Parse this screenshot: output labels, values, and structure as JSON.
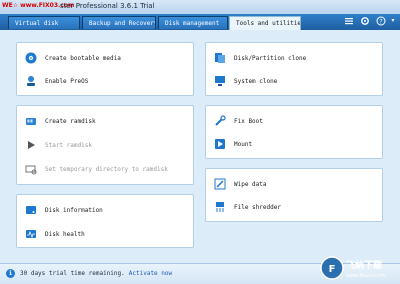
{
  "window": {
    "watermark": "WE☆ www.FIX03.com",
    "title": "ster Professional 3.6.1 Trial",
    "menu_icon": "menu-icon",
    "settings_icon": "gear-icon",
    "help_icon": "help-icon"
  },
  "tabs": [
    {
      "label": "Virtual disk",
      "active": false
    },
    {
      "label": "Backup and Recovery",
      "active": false
    },
    {
      "label": "Disk management",
      "active": false
    },
    {
      "label": "Tools and utilities",
      "active": true
    }
  ],
  "panels": {
    "boot": {
      "items": [
        {
          "label": "Create bootable media",
          "icon": "disc-icon",
          "enabled": true
        },
        {
          "label": "Enable PreOS",
          "icon": "preos-icon",
          "enabled": true
        }
      ]
    },
    "ramdisk": {
      "items": [
        {
          "label": "Create ramdisk",
          "icon": "ramdisk-icon",
          "enabled": true
        },
        {
          "label": "Start ramdisk",
          "icon": "play-icon",
          "enabled": false
        },
        {
          "label": "Set temporary directory to ramdisk",
          "icon": "folder-gear-icon",
          "enabled": false
        }
      ]
    },
    "disk": {
      "items": [
        {
          "label": "Disk information",
          "icon": "disk-info-icon",
          "enabled": true
        },
        {
          "label": "Disk health",
          "icon": "disk-health-icon",
          "enabled": true
        }
      ]
    },
    "clone": {
      "items": [
        {
          "label": "Disk/Partition clone",
          "icon": "clone-disk-icon",
          "enabled": true
        },
        {
          "label": "System clone",
          "icon": "system-clone-icon",
          "enabled": true
        }
      ]
    },
    "fix": {
      "items": [
        {
          "label": "Fix Boot",
          "icon": "wrench-icon",
          "enabled": true
        },
        {
          "label": "Mount",
          "icon": "mount-icon",
          "enabled": true
        }
      ]
    },
    "wipe": {
      "items": [
        {
          "label": "Wipe data",
          "icon": "eraser-icon",
          "enabled": true
        },
        {
          "label": "File shredder",
          "icon": "shredder-icon",
          "enabled": true
        }
      ]
    }
  },
  "status": {
    "text": "30 days trial time remaining.",
    "link": "Activate now",
    "icon": "info-icon"
  },
  "logo": {
    "text_cn": "飞纳下载",
    "text_en": "www.fixunr.com"
  },
  "colors": {
    "titlebar": "#c9def2",
    "tabbar": "#2a72ba",
    "content_bg": "#dcecf8",
    "link": "#1d59b3",
    "accent": "#1e78d0"
  }
}
